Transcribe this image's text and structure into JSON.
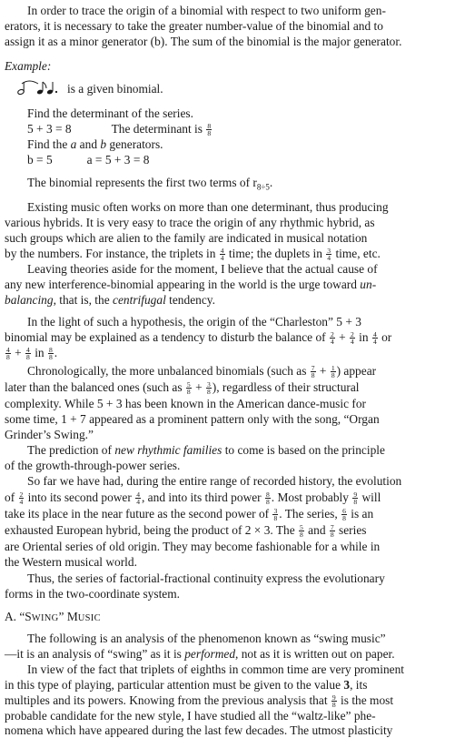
{
  "paragraph_intro": [
    "In order to trace the origin of a binomial with respect to two uniform gen-",
    "erators, it is necessary to take the greater number-value of the binomial and to",
    "assign it as a minor generator (b).  The sum of the binomial is the major generator."
  ],
  "example_label": "Example:",
  "example_given": "is a given binomial.",
  "steps": {
    "find_determinant": "Find the determinant of the series.",
    "sum_expr": "5 + 3 = 8",
    "determinant_text": "The determinant is",
    "determinant_frac": [
      "8",
      "8"
    ],
    "find_generators_pre": "Find the ",
    "find_generators_a": "a",
    "find_generators_mid": " and ",
    "find_generators_b": "b",
    "find_generators_post": " generators.",
    "b_expr": "b = 5",
    "a_expr": "a = 5 + 3 = 8"
  },
  "binomial_represents": {
    "text": "The binomial represents the first two terms of r",
    "subscript": "8÷5",
    "end": "."
  },
  "para_existing": {
    "l1": "Existing music often works on more than one determinant, thus producing",
    "l2": "various hybrids.  It is very easy to trace the origin of any rhythmic hybrid, as",
    "l3": "such groups which are alien to the family are indicated in musical notation",
    "l4a": "by the numbers.  For instance, the triplets in ",
    "l4_frac1": [
      "4",
      "4"
    ],
    "l4b": " time; the duplets in ",
    "l4_frac2": [
      "3",
      "4"
    ],
    "l4c": " time, etc."
  },
  "para_leaving": {
    "l1": "Leaving theories aside for the moment, I believe that the actual cause of",
    "l2a": "any new interference-binomial appearing in the world is the urge toward ",
    "l2b": "un-",
    "l3a": "balancing",
    "l3b": ", that is, the ",
    "l3c": "centrifugal",
    "l3d": " tendency."
  },
  "para_light": {
    "l1": "In the light of such a hypothesis, the origin of the “Charleston” 5 + 3",
    "l2a": "binomial may be explained as a tendency to disturb the balance of ",
    "l2_f1": [
      "2",
      "4"
    ],
    "l2_plus": " + ",
    "l2_f2": [
      "2",
      "4"
    ],
    "l2_in": " in ",
    "l2_f3": [
      "4",
      "4"
    ],
    "l2_or": " or",
    "l3_f1": [
      "4",
      "8"
    ],
    "l3_plus": " + ",
    "l3_f2": [
      "4",
      "8"
    ],
    "l3_in": " in ",
    "l3_f3": [
      "8",
      "8"
    ],
    "l3_end": "."
  },
  "para_chrono": {
    "l1a": "Chronologically, the more unbalanced binomials (such as ",
    "l1_f1": [
      "7",
      "8"
    ],
    "l1_plus": " + ",
    "l1_f2": [
      "1",
      "8"
    ],
    "l1b": ") appear",
    "l2a": "later than the balanced ones (such as ",
    "l2_f1": [
      "5",
      "8"
    ],
    "l2_plus": " + ",
    "l2_f2": [
      "3",
      "8"
    ],
    "l2b": "), regardless of their structural",
    "l3": "complexity.  While 5 + 3 has been known in the American dance-music for",
    "l4": "some time, 1 + 7 appeared as a prominent pattern only with the song, “Organ",
    "l5": "Grinder’s Swing.”"
  },
  "para_prediction": {
    "l1a": "The prediction of ",
    "l1b": "new rhythmic families",
    "l1c": " to come is based on the principle",
    "l2": "of the growth-through-power series."
  },
  "para_sofar": {
    "l1": "So far we have had, during the entire range of recorded history, the evolution",
    "l2a": "of ",
    "l2_f1": [
      "2",
      "4"
    ],
    "l2b": " into its second power ",
    "l2_f2": [
      "4",
      "4"
    ],
    "l2c": ", and into its third power ",
    "l2_f3": [
      "8",
      "8"
    ],
    "l2d": ".  Most probably ",
    "l2_f4": [
      "9",
      "8"
    ],
    "l2e": " will",
    "l3a": "take its place in the near future as the second power of ",
    "l3_f1": [
      "3",
      "8"
    ],
    "l3b": ".  The series, ",
    "l3_f2": [
      "6",
      "8"
    ],
    "l3c": " is an",
    "l4a": "exhausted European hybrid, being the product of  2 × 3.  The ",
    "l4_f1": [
      "5",
      "8"
    ],
    "l4b": " and ",
    "l4_f2": [
      "7",
      "8"
    ],
    "l4c": " series",
    "l5": "are Oriental series of old origin.  They may become fashionable for a while in",
    "l6": "the Western musical world."
  },
  "para_thus": {
    "l1": "Thus, the series of factorial-fractional continuity express the evolutionary",
    "l2": "forms in the two-coordinate system."
  },
  "section_heading": {
    "prefix": "A.  “S",
    "small1": "WING",
    "mid": "” M",
    "small2": "USIC"
  },
  "para_following": {
    "l1": "The following is an analysis of the phenomenon known as “swing music”",
    "l2a": "—it is an analysis of “swing” as it is ",
    "l2b": "performed",
    "l2c": ", not as it is written out on paper."
  },
  "para_view": {
    "l1": "In view of the fact that triplets of eighths in common time are very prominent",
    "l2a": "in this type of playing, particular attention must be given to the value ",
    "l2b": "3",
    "l2c": ", its",
    "l3a": "multiples and its powers.  Knowing from the previous analysis that ",
    "l3_f1": [
      "9",
      "8"
    ],
    "l3b": " is the most",
    "l4": "probable candidate for the new style, I have studied all the “waltz-like” phe-",
    "l5": "nomena which have appeared during the last few decades.  The utmost plasticity"
  }
}
